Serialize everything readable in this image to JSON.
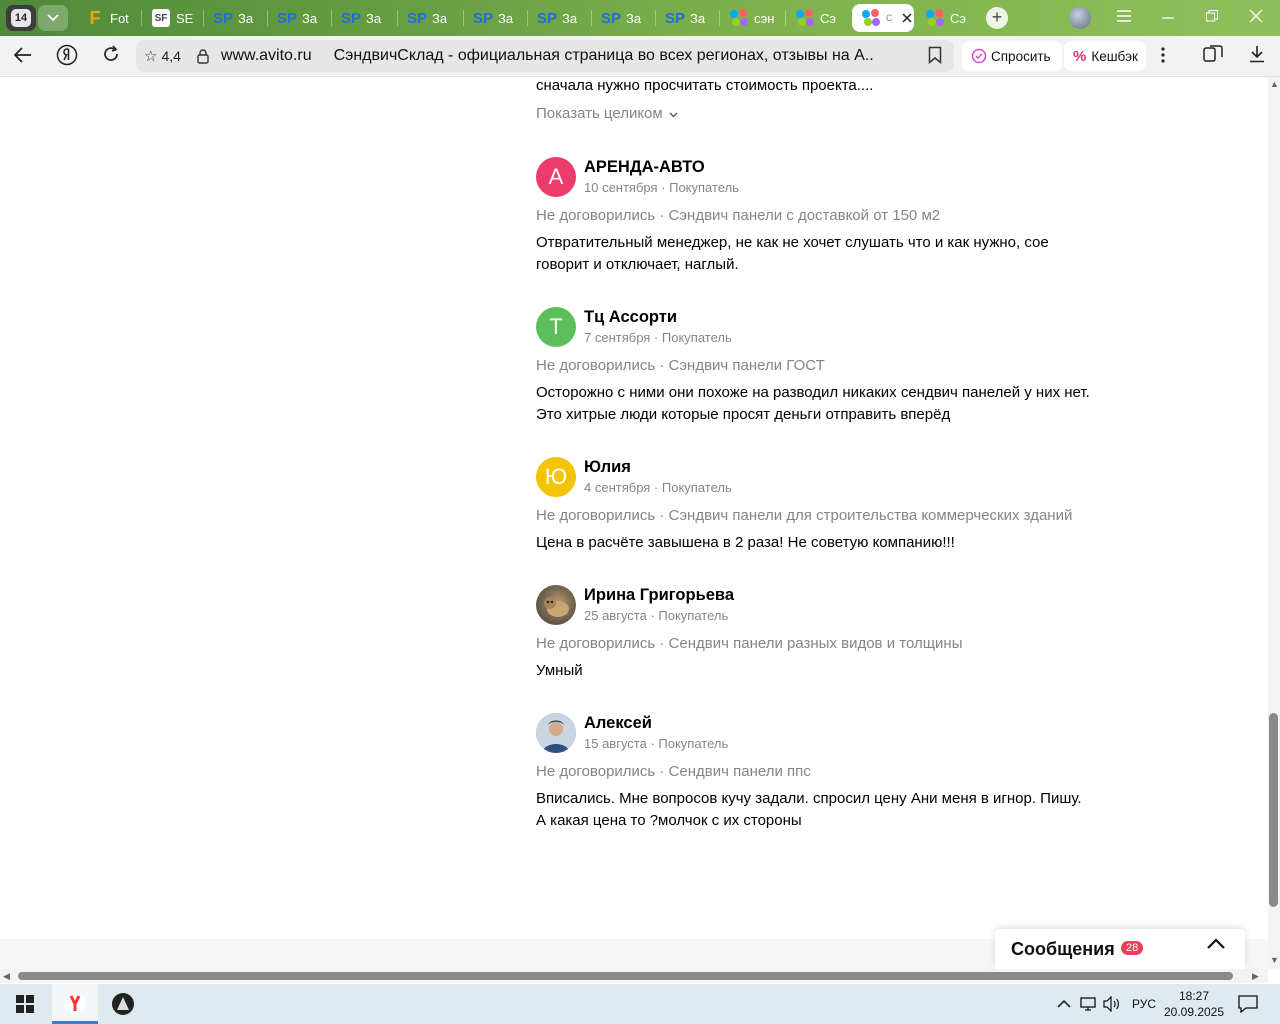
{
  "browser": {
    "tab_count": "14",
    "tabs": [
      {
        "label": "Fot",
        "fav": "F"
      },
      {
        "label": "SE",
        "fav": "SF"
      },
      {
        "label": "За",
        "fav": "SP"
      },
      {
        "label": "За",
        "fav": "SP"
      },
      {
        "label": "За",
        "fav": "SP"
      },
      {
        "label": "За",
        "fav": "SP"
      },
      {
        "label": "За",
        "fav": "SP"
      },
      {
        "label": "За",
        "fav": "SP"
      },
      {
        "label": "За",
        "fav": "SP"
      },
      {
        "label": "За",
        "fav": "SP"
      },
      {
        "label": "сэн",
        "fav": "avito"
      },
      {
        "label": "Сэ",
        "fav": "avito"
      },
      {
        "label": "С",
        "fav": "avito"
      },
      {
        "label": "Сэ",
        "fav": "avito"
      }
    ],
    "rating": "4,4",
    "domain": "www.avito.ru",
    "page_title": "СэндвичСклад - официальная страница во всех регионах, отзывы на А...",
    "ask_label": "Спросить",
    "cashback_label": "Кешбэк"
  },
  "page": {
    "prev_text": "сначала нужно просчитать стоимость проекта....",
    "show_all": "Показать целиком",
    "reviews": [
      {
        "initial": "А",
        "color": "#ec3b6c",
        "name": "АРЕНДА-АВТО",
        "meta": "10 сентября · Покупатель",
        "deal": "Не договорились · Сэндвич панели с доставкой от 150 м2",
        "text": "Отвратительный менеджер, не как не хочет слушать что и как нужно, сое говорит и отключает, наглый."
      },
      {
        "initial": "Т",
        "color": "#5cbf5c",
        "name": "Тц Ассорти",
        "meta": "7 сентября · Покупатель",
        "deal": "Не договорились · Сэндвич панели ГОСТ",
        "text": "Осторожно с ними они похоже на разводил никаких сендвич панелей у них нет. Это хитрые люди которые просят деньги отправить вперёд"
      },
      {
        "initial": "Ю",
        "color": "#f5c400",
        "name": "Юлия",
        "meta": "4 сентября · Покупатель",
        "deal": "Не договорились · Сэндвич панели для строительства коммерческих зданий",
        "text": "Цена в расчёте завышена в 2 раза! Не советую компанию!!!"
      },
      {
        "initial": "",
        "color": "#7a6a52",
        "name": "Ирина Григорьева",
        "meta": "25 августа · Покупатель",
        "deal": "Не договорились · Сендвич панели разных видов и толщины",
        "text": "Умный"
      },
      {
        "initial": "",
        "color": "#3e5a7a",
        "name": "Алексей",
        "meta": "15 августа · Покупатель",
        "deal": "Не договорились · Сендвич панели ппс",
        "text": "Вписались. Мне вопросов кучу задали. спросил цену Ани меня в игнор. Пишу. А какая цена то ?молчок с их стороны"
      }
    ],
    "messages_label": "Сообщения",
    "messages_count": "28"
  },
  "taskbar": {
    "lang": "РУС",
    "time": "18:27",
    "date": "20.09.2025"
  }
}
